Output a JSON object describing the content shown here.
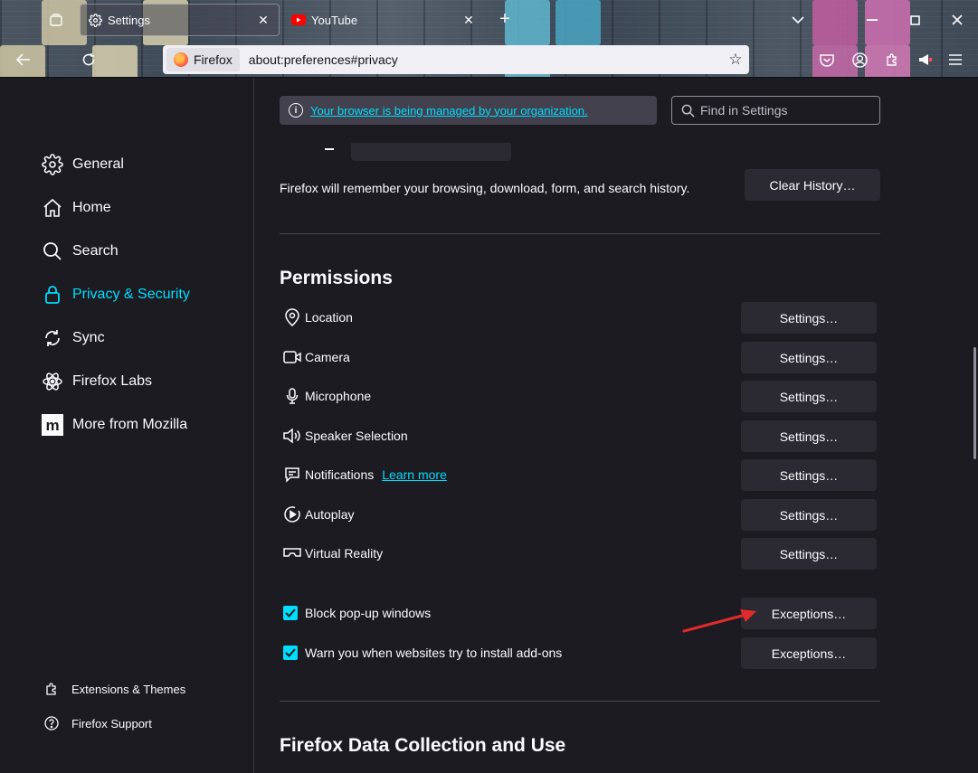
{
  "tabs": [
    {
      "title": "Settings",
      "icon": "gear-icon",
      "active": true
    },
    {
      "title": "YouTube",
      "icon": "youtube-icon",
      "active": false
    }
  ],
  "urlbar": {
    "identity_label": "Firefox",
    "url": "about:preferences#privacy"
  },
  "sidebar": {
    "categories": [
      {
        "label": "General",
        "icon": "gear-icon"
      },
      {
        "label": "Home",
        "icon": "home-icon"
      },
      {
        "label": "Search",
        "icon": "search-icon"
      },
      {
        "label": "Privacy & Security",
        "icon": "lock-icon",
        "selected": true
      },
      {
        "label": "Sync",
        "icon": "sync-icon"
      },
      {
        "label": "Firefox Labs",
        "icon": "labs-icon"
      },
      {
        "label": "More from Mozilla",
        "icon": "mozilla-icon"
      }
    ],
    "footer": [
      {
        "label": "Extensions & Themes",
        "icon": "puzzle-icon"
      },
      {
        "label": "Firefox Support",
        "icon": "help-icon"
      }
    ]
  },
  "policies": {
    "link_text": "Your browser is being managed by your organization."
  },
  "search": {
    "placeholder": "Find in Settings"
  },
  "history": {
    "description": "Firefox will remember your browsing, download, form, and search history.",
    "clear_button": "Clear History…"
  },
  "permissions": {
    "title": "Permissions",
    "settings_button": "Settings…",
    "items": [
      {
        "label": "Location",
        "icon": "location-icon"
      },
      {
        "label": "Camera",
        "icon": "camera-icon"
      },
      {
        "label": "Microphone",
        "icon": "microphone-icon"
      },
      {
        "label": "Speaker Selection",
        "icon": "speaker-icon"
      },
      {
        "label": "Notifications",
        "icon": "notification-icon",
        "learn_more": "Learn more"
      },
      {
        "label": "Autoplay",
        "icon": "autoplay-icon"
      },
      {
        "label": "Virtual Reality",
        "icon": "vr-icon"
      }
    ],
    "checkboxes": [
      {
        "label": "Block pop-up windows",
        "checked": true,
        "button": "Exceptions…"
      },
      {
        "label": "Warn you when websites try to install add-ons",
        "checked": true,
        "button": "Exceptions…"
      }
    ]
  },
  "data_collection": {
    "title": "Firefox Data Collection and Use"
  },
  "colors": {
    "accent": "#00ddff",
    "background": "#1c1b22",
    "button": "#2b2a33",
    "annotation_arrow": "#e22b2b"
  }
}
